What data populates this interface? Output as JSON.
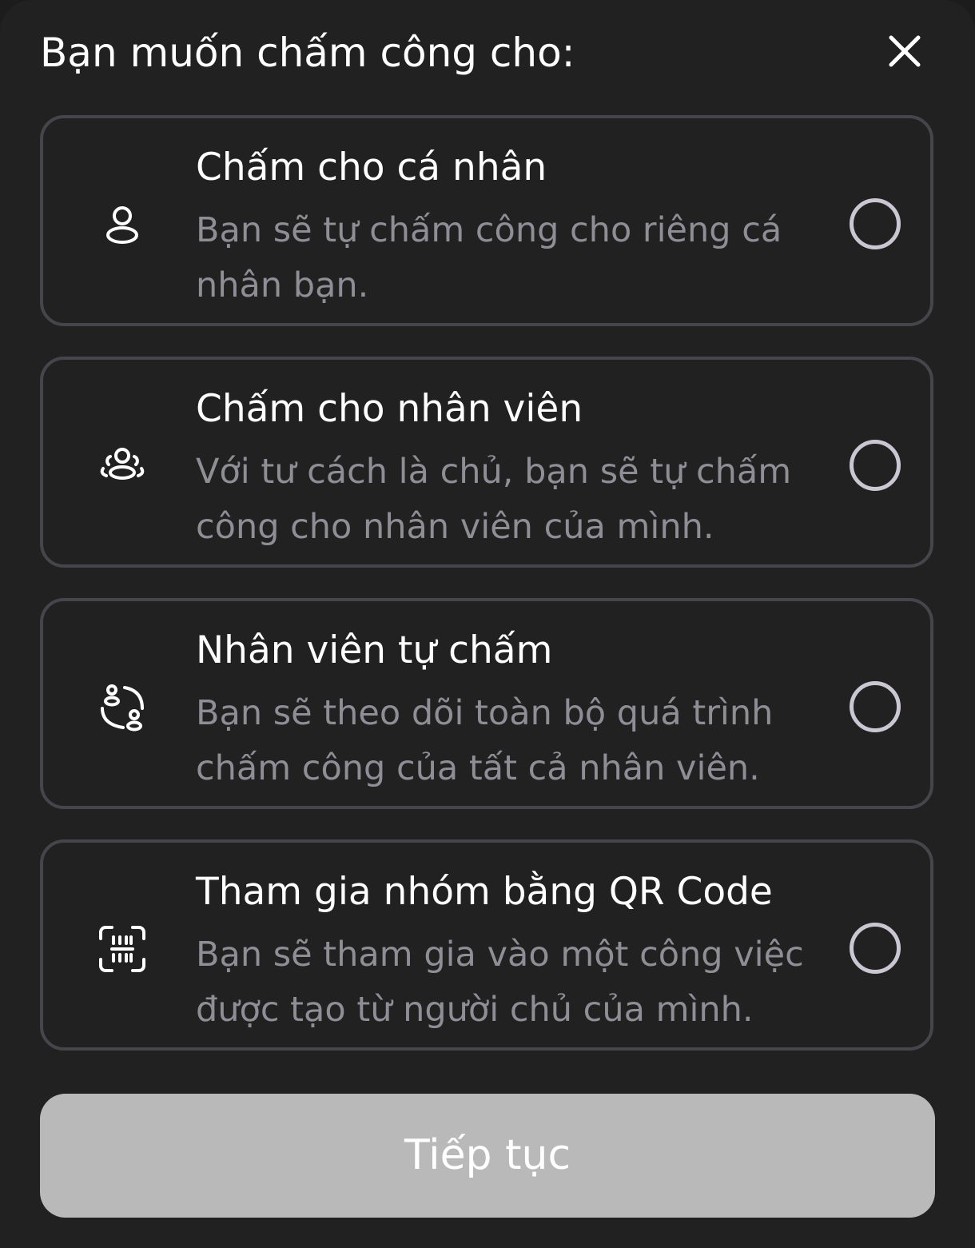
{
  "header": {
    "title": "Bạn muốn chấm công cho:",
    "close_icon": "close-icon"
  },
  "options": [
    {
      "icon": "person-icon",
      "title": "Chấm cho cá nhân",
      "description": "Bạn sẽ tự chấm công cho riêng cá nhân bạn.",
      "selected": false
    },
    {
      "icon": "group-icon",
      "title": "Chấm cho nhân viên",
      "description": "Với tư cách là chủ, bạn sẽ tự chấm công cho nhân viên của mình.",
      "selected": false
    },
    {
      "icon": "people-exchange-icon",
      "title": "Nhân viên tự chấm",
      "description": "Bạn sẽ theo dõi toàn bộ quá trình chấm công của tất cả nhân viên.",
      "selected": false
    },
    {
      "icon": "qr-scan-icon",
      "title": "Tham gia nhóm bằng QR Code",
      "description": "Bạn sẽ tham gia vào một công việc được tạo từ người chủ của mình.",
      "selected": false
    }
  ],
  "footer": {
    "continue_label": "Tiếp tục"
  },
  "colors": {
    "background": "#212121",
    "card_border": "#46454c",
    "description_text": "#8f8d95",
    "radio_border": "#cbc7d2",
    "button_disabled": "#b9b9b9"
  }
}
